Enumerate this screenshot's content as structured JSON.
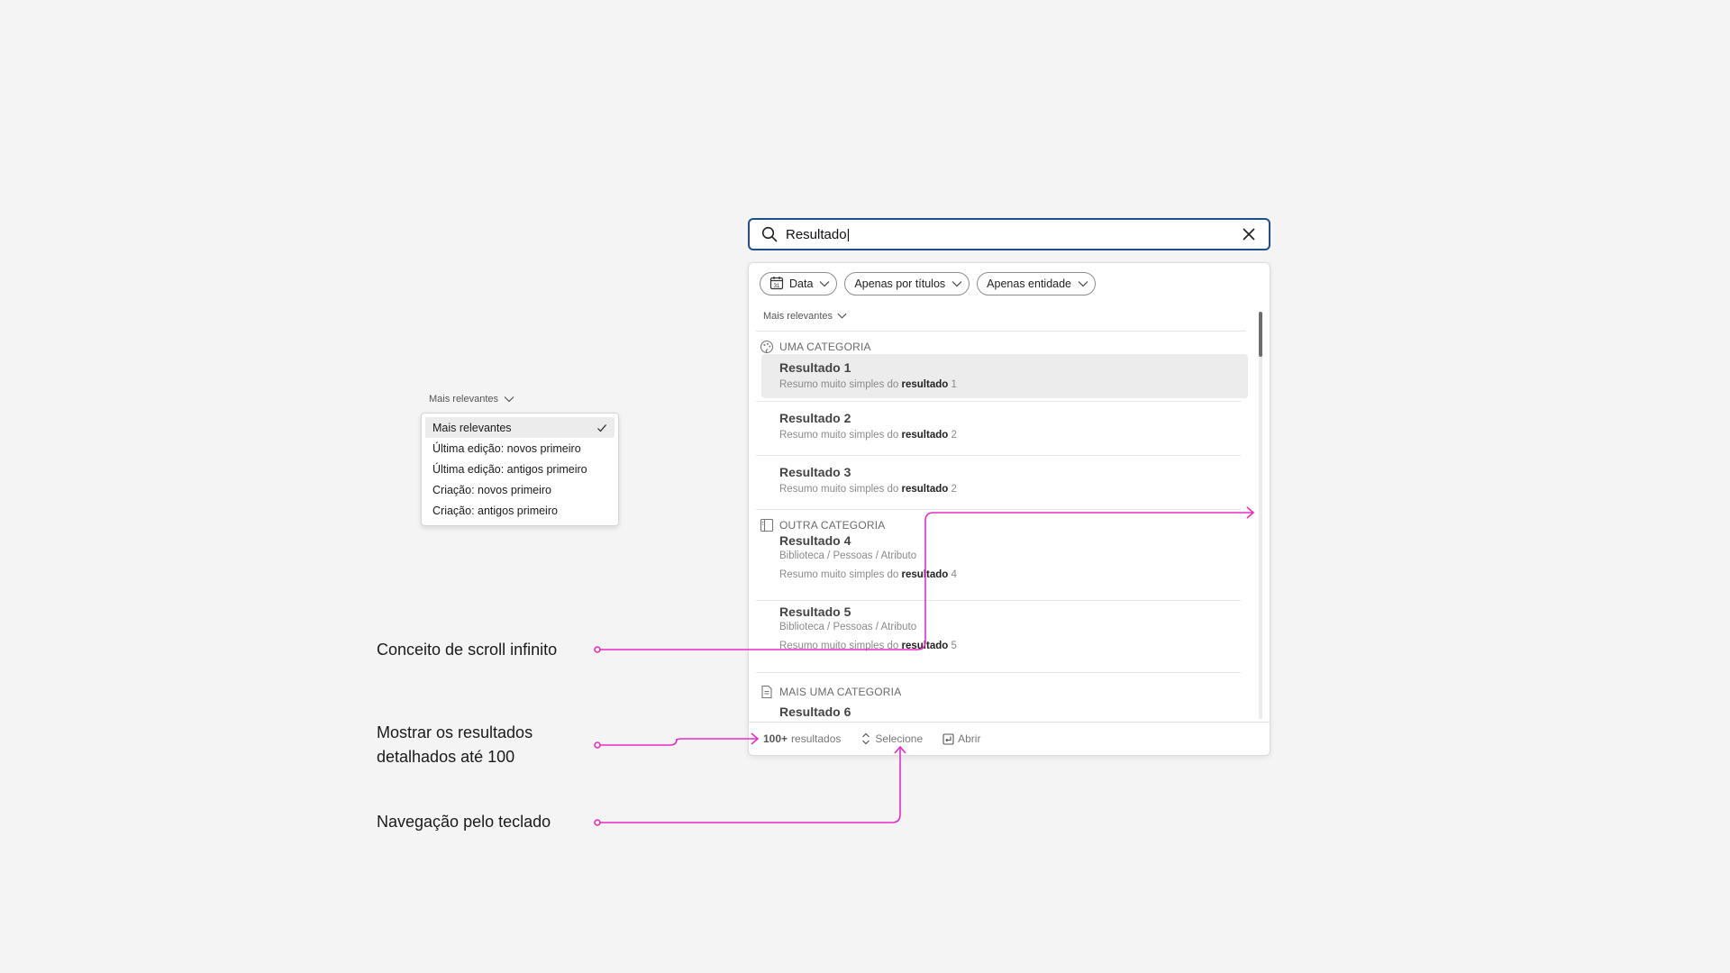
{
  "search": {
    "value": "Resultado|",
    "placeholder": ""
  },
  "filters": [
    {
      "label": "Data",
      "icon": "calendar-icon"
    },
    {
      "label": "Apenas por títulos"
    },
    {
      "label": "Apenas entidade"
    }
  ],
  "sort": {
    "label": "Mais relevantes"
  },
  "categories": [
    {
      "label": "UMA CATEGORIA",
      "icon": "palette-icon"
    },
    {
      "label": "OUTRA CATEGORIA",
      "icon": "book-icon"
    },
    {
      "label": "MAIS UMA CATEGORIA",
      "icon": "document-icon"
    }
  ],
  "results": [
    {
      "title": "Resultado 1",
      "summary_prefix": "Resumo muito simples do",
      "summary_bold": "resultado",
      "summary_suffix": "1"
    },
    {
      "title": "Resultado 2",
      "summary_prefix": "Resumo muito simples do",
      "summary_bold": "resultado",
      "summary_suffix": "2"
    },
    {
      "title": "Resultado 3",
      "summary_prefix": "Resumo muito simples do",
      "summary_bold": "resultado",
      "summary_suffix": "2"
    },
    {
      "title": "Resultado 4",
      "path": "Biblioteca / Pessoas / Atributo",
      "summary_prefix": "Resumo muito simples do",
      "summary_bold": "resultado",
      "summary_suffix": "4"
    },
    {
      "title": "Resultado 5",
      "path": "Biblioteca / Pessoas / Atributo",
      "summary_prefix": "Resumo muito simples do",
      "summary_bold": "resultado",
      "summary_suffix": "5"
    },
    {
      "title": "Resultado 6"
    }
  ],
  "footer": {
    "count_bold": "100+",
    "count_text": "resultados",
    "select_label": "Selecione",
    "open_label": "Abrir"
  },
  "sort_dropdown": {
    "label": "Mais relevantes",
    "options": [
      {
        "label": "Mais relevantes",
        "selected": true
      },
      {
        "label": "Última edição: novos primeiro"
      },
      {
        "label": "Última edição: antigos primeiro"
      },
      {
        "label": "Criação: novos primeiro"
      },
      {
        "label": "Criação: antigos primeiro"
      }
    ]
  },
  "annotations": {
    "scroll": "Conceito de scroll infinito",
    "results_line1": "Mostrar os resultados",
    "results_line2": "detalhados até 100",
    "keyboard": "Navegação pelo teclado"
  },
  "colors": {
    "accent": "#1f4e8c",
    "annotation": "#e82bc8"
  }
}
